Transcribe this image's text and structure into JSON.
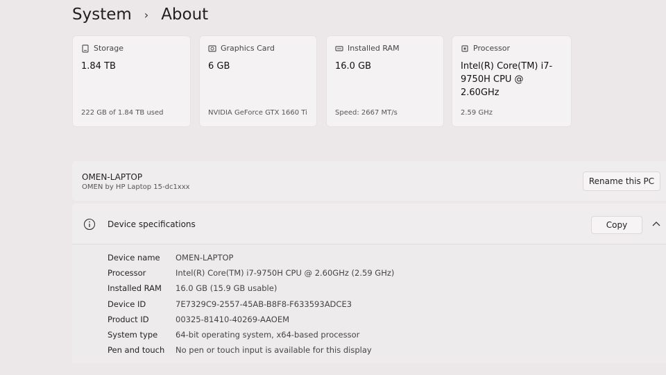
{
  "breadcrumb": {
    "parent": "System",
    "current": "About"
  },
  "cards": [
    {
      "icon": "storage-icon",
      "label": "Storage",
      "value": "1.84 TB",
      "sub": "222 GB of 1.84 TB used"
    },
    {
      "icon": "graphics-card-icon",
      "label": "Graphics Card",
      "value": "6 GB",
      "sub": "NVIDIA GeForce GTX 1660 Ti"
    },
    {
      "icon": "ram-icon",
      "label": "Installed RAM",
      "value": "16.0 GB",
      "sub": "Speed: 2667 MT/s"
    },
    {
      "icon": "processor-icon",
      "label": "Processor",
      "value": "Intel(R) Core(TM) i7-9750H CPU @ 2.60GHz",
      "sub": "2.59 GHz"
    }
  ],
  "pc": {
    "name": "OMEN-LAPTOP",
    "model": "OMEN by HP Laptop 15-dc1xxx",
    "rename_label": "Rename this PC"
  },
  "device_specs": {
    "title": "Device specifications",
    "copy_label": "Copy",
    "rows": [
      {
        "key": "Device name",
        "value": "OMEN-LAPTOP"
      },
      {
        "key": "Processor",
        "value": "Intel(R) Core(TM) i7-9750H CPU @ 2.60GHz (2.59 GHz)"
      },
      {
        "key": "Installed RAM",
        "value": "16.0 GB (15.9 GB usable)"
      },
      {
        "key": "Device ID",
        "value": "7E7329C9-2557-45AB-B8F8-F633593ADCE3"
      },
      {
        "key": "Product ID",
        "value": "00325-81410-40269-AAOEM"
      },
      {
        "key": "System type",
        "value": "64-bit operating system, x64-based processor"
      },
      {
        "key": "Pen and touch",
        "value": "No pen or touch input is available for this display"
      }
    ]
  }
}
